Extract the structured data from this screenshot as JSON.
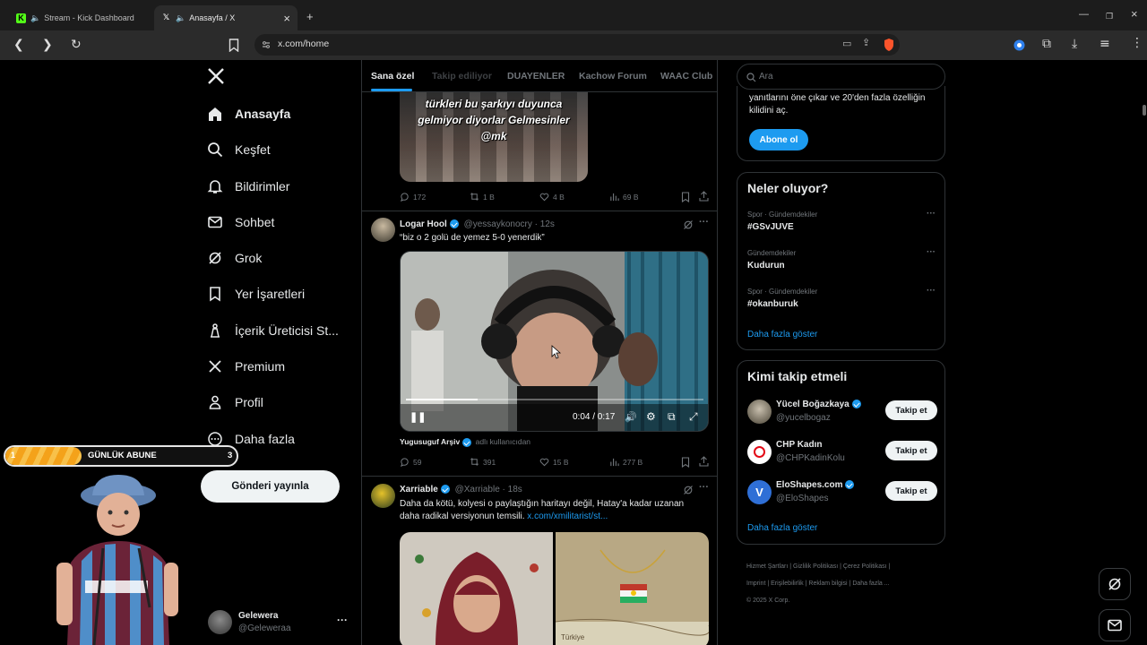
{
  "browser": {
    "tabs": [
      {
        "title": "Stream - Kick Dashboard",
        "icon": "kick-icon",
        "active": false
      },
      {
        "title": "Anasayfa / X",
        "icon": "x-logo-icon",
        "active": true
      }
    ],
    "new_tab": "+",
    "url": "x.com/home"
  },
  "sidebar": {
    "items": [
      {
        "label": "Anasayfa",
        "icon": "home-icon"
      },
      {
        "label": "Keşfet",
        "icon": "search-icon"
      },
      {
        "label": "Bildirimler",
        "icon": "bell-icon"
      },
      {
        "label": "Sohbet",
        "icon": "mail-icon"
      },
      {
        "label": "Grok",
        "icon": "grok-icon"
      },
      {
        "label": "Yer İşaretleri",
        "icon": "bookmark-icon"
      },
      {
        "label": "İçerik Üreticisi St...",
        "icon": "creator-studio-icon"
      },
      {
        "label": "Premium",
        "icon": "x-premium-icon"
      },
      {
        "label": "Profil",
        "icon": "profile-icon"
      },
      {
        "label": "Daha fazla",
        "icon": "more-icon"
      }
    ],
    "post_button": "Gönderi yayınla",
    "account": {
      "name": "Gelewera",
      "handle": "@Geleweraa"
    }
  },
  "overlay": {
    "goal_label": "GÜNLÜK ABUNE",
    "goal_current": "1",
    "goal_target": "3",
    "goal_progress": 0.33
  },
  "feed": {
    "tabs": [
      "Sana özel",
      "Takip ediliyor",
      "DUAYENLER",
      "Kachow Forum",
      "WAAC Club"
    ],
    "posts": [
      {
        "media_caption": "türkleri bu şarkıyı duyunca gelmiyor diyorlar Gelmesinler @mk",
        "replies": "172",
        "reposts": "1 B",
        "likes": "4 B",
        "views": "69 B"
      },
      {
        "name": "Logar Hool",
        "handle": "@yessaykonocry",
        "time": "12s",
        "text": "“biz o 2 golü de yemez 5-0 yenerdik”",
        "video_time": "0:04 / 0:17",
        "video_progress": 0.24,
        "source_name": "Yugusuguf Arşiv",
        "source_suffix": "adlı kullanıcıdan",
        "replies": "59",
        "reposts": "391",
        "likes": "15 B",
        "views": "277 B"
      },
      {
        "name": "Xarriable",
        "handle": "@Xarriable",
        "time": "18s",
        "text": "Daha da kötü, kolyesi o paylaştığın haritayı değil, Hatay'a kadar uzanan daha radikal versiyonun temsili.",
        "link": "x.com/xmilitarist/st...",
        "map_label": "Türkiye"
      }
    ]
  },
  "right": {
    "search_placeholder": "Ara",
    "premium_text": "yanıtlarını öne çıkar ve 20'den fazla özelliğin kilidini aç.",
    "subscribe": "Abone ol",
    "trends_title": "Neler oluyor?",
    "trends": [
      {
        "category": "Spor · Gündemdekiler",
        "name": "#GSvJUVE"
      },
      {
        "category": "Gündemdekiler",
        "name": "Kudurun"
      },
      {
        "category": "Spor · Gündemdekiler",
        "name": "#okanburuk"
      }
    ],
    "show_more": "Daha fazla göster",
    "who_title": "Kimi takip etmeli",
    "who": [
      {
        "name": "Yücel Boğazkaya",
        "handle": "@yucelbogaz",
        "button": "Takip et"
      },
      {
        "name": "CHP Kadın",
        "handle": "@CHPKadinKolu",
        "button": "Takip et"
      },
      {
        "name": "EloShapes.com",
        "handle": "@EloShapes",
        "button": "Takip et"
      }
    ],
    "footer": [
      "Hizmet Şartları",
      "Gizlilik Politikası",
      "Çerez Politikası",
      "Imprint",
      "Erişilebilirlik",
      "Reklam bilgisi",
      "Daha fazla ...",
      "© 2025 X Corp."
    ]
  },
  "colors": {
    "accent": "#1d9bf0",
    "background": "#000000",
    "border": "#2f3336",
    "muted": "#71767b"
  }
}
